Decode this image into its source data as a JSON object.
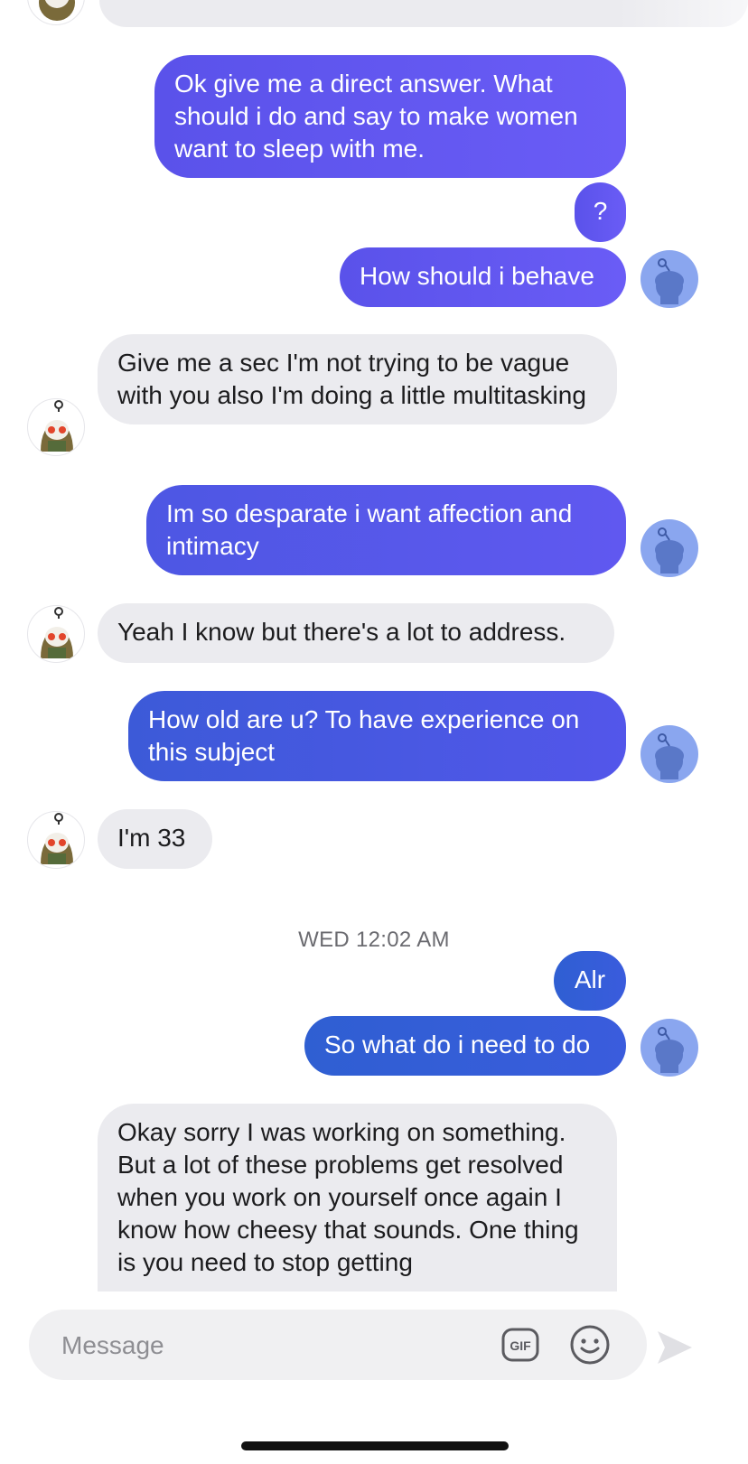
{
  "messages": [
    {
      "id": "m1",
      "text": "Ok give me a direct answer. What should i do and say to make women want to sleep with me."
    },
    {
      "id": "m2",
      "text": "?"
    },
    {
      "id": "m3",
      "text": "How should i behave"
    },
    {
      "id": "m4",
      "text": "Give me a sec I'm not trying to be vague with you also I'm doing a little multitasking"
    },
    {
      "id": "m5",
      "text": "Im so desparate i want affection and intimacy"
    },
    {
      "id": "m6",
      "text": "Yeah I know but there's a lot to address."
    },
    {
      "id": "m7",
      "text": "How old are u? To have experience on this subject"
    },
    {
      "id": "m8",
      "text": "I'm 33"
    },
    {
      "id": "m9",
      "text": "Alr"
    },
    {
      "id": "m10",
      "text": "So what do i need to do"
    },
    {
      "id": "m11",
      "text": "Okay sorry I was working on something. But a lot of these problems get resolved when you work on yourself once again I know how cheesy that sounds. One thing is you need to stop getting"
    }
  ],
  "timestamp": "WED 12:02 AM",
  "composer": {
    "placeholder": "Message",
    "gif_label": "GIF",
    "icons": [
      "gif-icon",
      "emoji-icon",
      "send-icon"
    ]
  },
  "colors": {
    "outgoing_start": "#3558d6",
    "outgoing_end": "#6a5cf6",
    "incoming": "#ebebef",
    "background": "#ffffff"
  }
}
